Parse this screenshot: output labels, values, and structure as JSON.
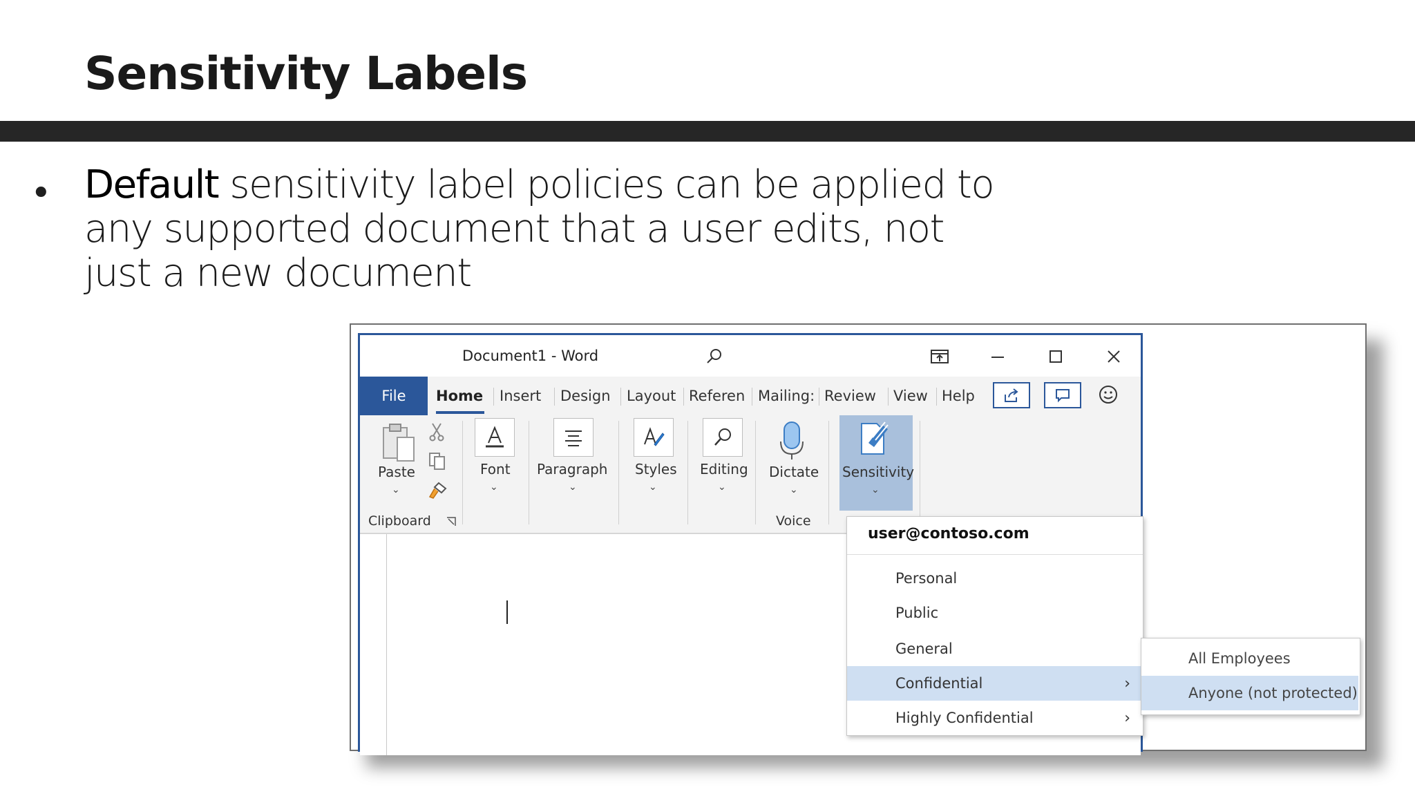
{
  "slide": {
    "title": "Sensitivity Labels",
    "bullet_strong": "Default",
    "bullet_rest": " sensitivity label policies can be applied to any supported document that a user edits, not just a new document"
  },
  "word": {
    "window_title": "Document1 - Word",
    "tabs": [
      "File",
      "Home",
      "Insert",
      "Design",
      "Layout",
      "Referen",
      "Mailing:",
      "Review",
      "View",
      "Help"
    ],
    "ribbon": {
      "paste": "Paste",
      "clipboard": "Clipboard",
      "font": "Font",
      "paragraph": "Paragraph",
      "styles": "Styles",
      "editing": "Editing",
      "dictate": "Dictate",
      "voice": "Voice",
      "sensitivity": "Sensitivity"
    },
    "sensitivity_menu": {
      "user": "user@contoso.com",
      "items": [
        "Personal",
        "Public",
        "General",
        "Confidential",
        "Highly Confidential"
      ],
      "highlighted": "Confidential",
      "submenu": [
        "All Employees",
        "Anyone (not protected)"
      ],
      "submenu_highlighted": "Anyone (not protected)"
    }
  }
}
